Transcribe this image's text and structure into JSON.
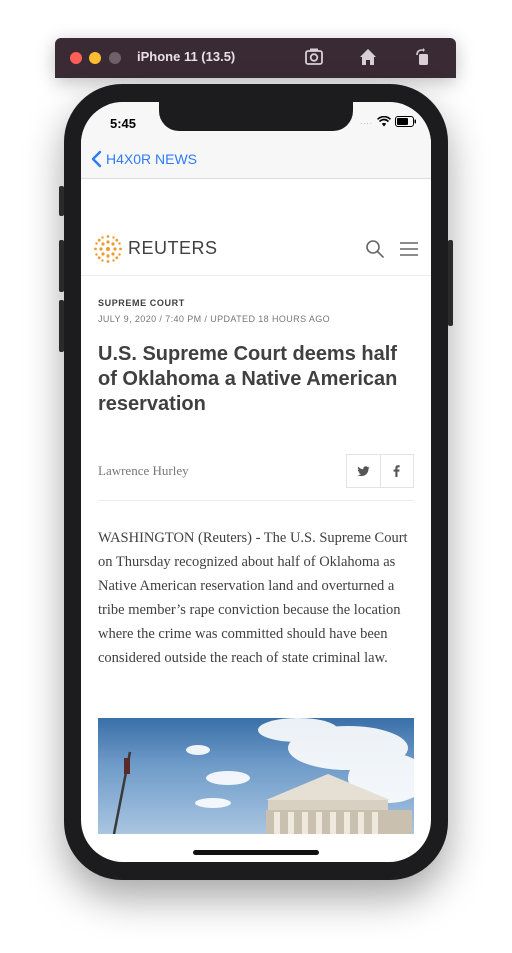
{
  "simulator": {
    "title": "iPhone 11 (13.5)"
  },
  "status_bar": {
    "time": "5:45"
  },
  "nav": {
    "back_label": "H4X0R NEWS"
  },
  "reuters": {
    "logo_text": "REUTERS",
    "brand_color": "#f09a2b"
  },
  "article": {
    "section": "SUPREME COURT",
    "dateline": "JULY 9, 2020 / 7:40 PM / UPDATED 18 HOURS AGO",
    "headline": "U.S. Supreme Court deems half of Oklahoma a Native American reservation",
    "author": "Lawrence Hurley",
    "share": {
      "twitter_icon": "twitter-icon",
      "facebook_icon": "facebook-icon"
    },
    "body": "WASHINGTON (Reuters) - The U.S. Supreme Court on Thursday recognized about half of Oklahoma as Native American reservation land and overturned a tribe member’s rape conviction because the location where the crime was committed should have been considered outside the reach of state criminal law."
  },
  "colors": {
    "link_blue": "#2e7bf6",
    "text_dark": "#404040",
    "text_muted": "#777777"
  }
}
